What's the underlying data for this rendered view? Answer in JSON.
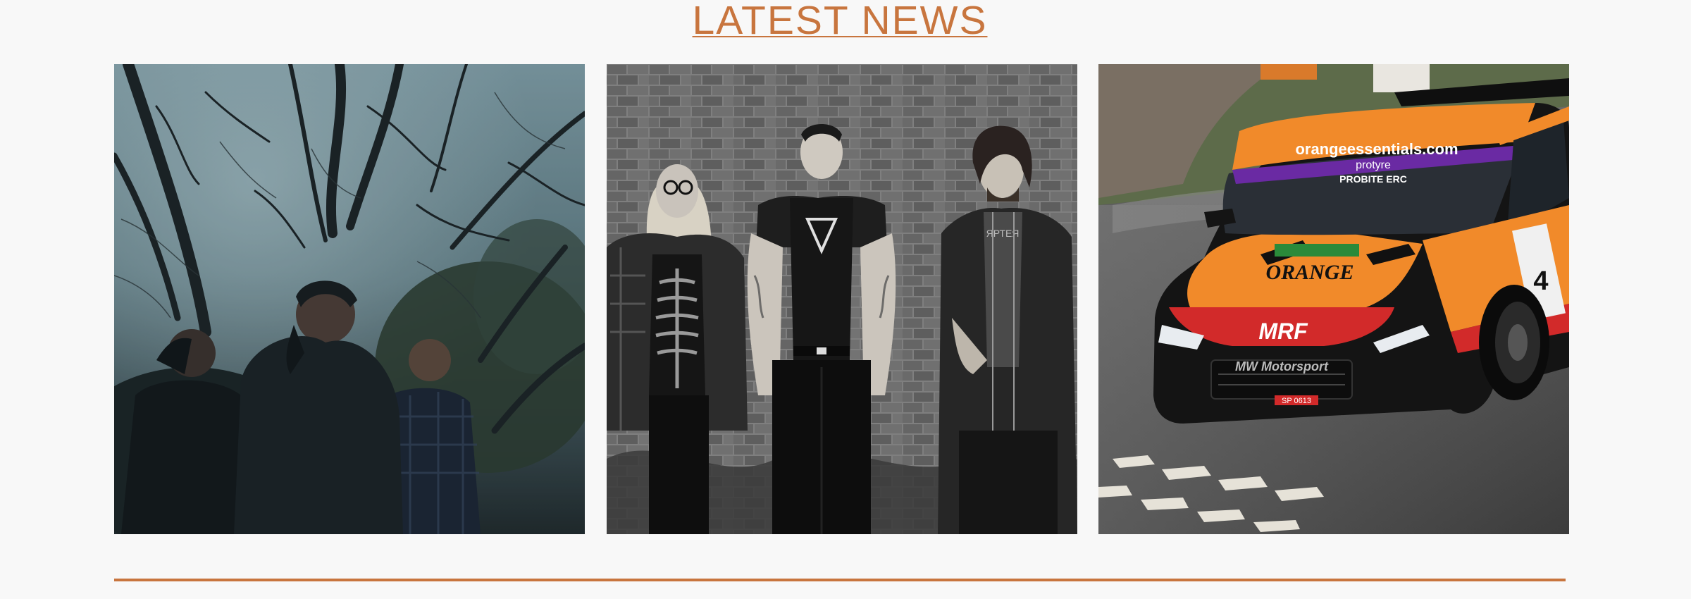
{
  "section": {
    "title": "LATEST NEWS"
  },
  "news_cards": [
    {
      "image_alt": "Band photo: three men among bare trees"
    },
    {
      "image_alt": "Band photo: three people in front of a brick wall"
    },
    {
      "image_alt": "Orange and black rally car on a wet road"
    }
  ],
  "rally_car": {
    "windscreen_text": "orangeessentials.com",
    "sponsor_1": "protyre",
    "sponsor_2": "PROBITE ERC",
    "hood_logo": "ORANGE",
    "bumper_logo": "MRF",
    "grille_text": "MW Motorsport",
    "plate": "SP 0613",
    "door_number": "4"
  },
  "colors": {
    "accent": "#c8753e",
    "background": "#f8f8f8"
  }
}
